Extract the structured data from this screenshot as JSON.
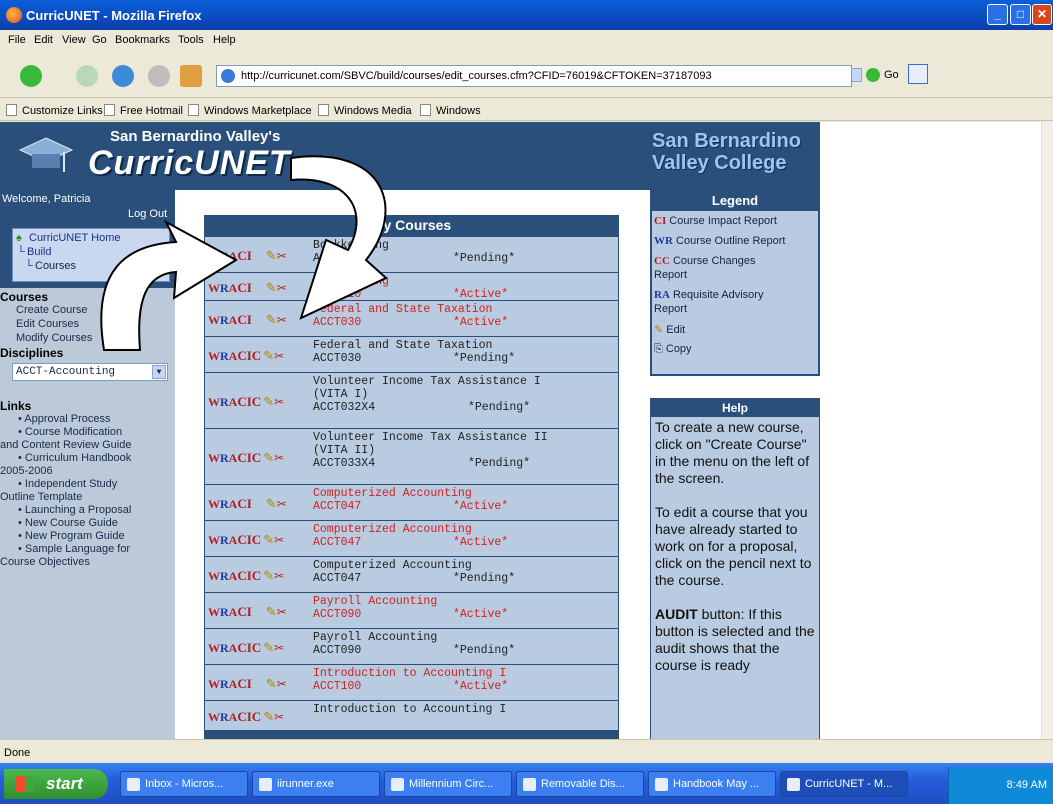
{
  "window": {
    "title": "CurricUNET - Mozilla Firefox"
  },
  "menu": [
    "File",
    "Edit",
    "View",
    "Go",
    "Bookmarks",
    "Tools",
    "Help"
  ],
  "nav": {
    "url": "http://curricunet.com/SBVC/build/courses/edit_courses.cfm?CFID=76019&CFTOKEN=37187093",
    "go_label": "Go"
  },
  "bookmarks": [
    "Customize Links",
    "Free Hotmail",
    "Windows Marketplace",
    "Windows Media",
    "Windows"
  ],
  "header": {
    "valley": "San Bernardino Valley's",
    "logo": "CurricUNET",
    "college_line1": "San Bernardino",
    "college_line2": "Valley College"
  },
  "sidebar": {
    "welcome": "Welcome, Patricia",
    "logout": "Log Out",
    "tree": [
      "CurricUNET Home",
      "Build",
      "Courses"
    ],
    "courses_title": "Courses",
    "course_items": [
      "Create Course",
      "Edit Courses",
      "Modify Courses"
    ],
    "disciplines_title": "Disciplines",
    "discipline_selected": "ACCT-Accounting",
    "links_title": "Links",
    "links": [
      "• Approval Process",
      "• Course Modification",
      "and Content Review Guide",
      "• Curriculum Handbook",
      "2005-2006",
      "• Independent Study",
      "Outline Template",
      "• Launching a Proposal",
      "• New Course Guide",
      "• New Program Guide",
      "• Sample Language for",
      "Course Objectives"
    ]
  },
  "courses": {
    "title": "My Courses",
    "rows": [
      {
        "line1": "Bookkeeping",
        "line2": "ACCT010",
        "status": "*Pending*"
      },
      {
        "line1": "Bookkeeping",
        "line2": "ACCT010",
        "status": "*Active*"
      },
      {
        "line1": "Federal and State Taxation",
        "line2": "ACCT030",
        "status": "*Active*"
      },
      {
        "line1": "Federal and State Taxation",
        "line2": "ACCT030",
        "status": "*Pending*"
      },
      {
        "line1": "Volunteer Income Tax Assistance I",
        "line1b": "(VITA I)",
        "line2": "ACCT032X4",
        "status": "*Pending*"
      },
      {
        "line1": "Volunteer Income Tax Assistance II",
        "line1b": "(VITA II)",
        "line2": "ACCT033X4",
        "status": "*Pending*"
      },
      {
        "line1": "Computerized Accounting",
        "line2": "ACCT047",
        "status": "*Active*"
      },
      {
        "line1": "Computerized Accounting",
        "line2": "ACCT047",
        "status": "*Active*"
      },
      {
        "line1": "Computerized Accounting",
        "line2": "ACCT047",
        "status": "*Pending*"
      },
      {
        "line1": "Payroll Accounting",
        "line2": "ACCT090",
        "status": "*Active*"
      },
      {
        "line1": "Payroll Accounting",
        "line2": "ACCT090",
        "status": "*Pending*"
      },
      {
        "line1": "Introduction to Accounting I",
        "line2": "ACCT100",
        "status": "*Active*"
      },
      {
        "line1": "Introduction to Accounting I",
        "line2": "",
        "status": ""
      }
    ]
  },
  "legend": {
    "title": "Legend",
    "items": [
      "Course Impact Report",
      "Course Outline Report",
      "Course Changes",
      "Report",
      "Requisite Advisory",
      "Report",
      "Edit",
      "Copy"
    ]
  },
  "help": {
    "title": "Help",
    "p1": "To create a new course, click on \"Create Course\" in the menu on the left of the screen.",
    "p2": "To edit a course that you have already started to work on for a proposal, click on the pencil next to the course.",
    "p3_bold": "AUDIT",
    "p3": " button: If this button is selected and the audit shows that the course is ready"
  },
  "status": "Done",
  "taskbar": {
    "start": "start",
    "items": [
      "Inbox - Micros...",
      "iirunner.exe",
      "Millennium Circ...",
      "Removable Dis...",
      "Handbook May ...",
      "CurricUNET - M..."
    ],
    "time": "8:49 AM"
  },
  "colors": {
    "header_bg": "#2a4f7a",
    "panel_bg": "#b8cbe0",
    "active_text": "#d42020",
    "titlebar": "#0b4bc0"
  }
}
